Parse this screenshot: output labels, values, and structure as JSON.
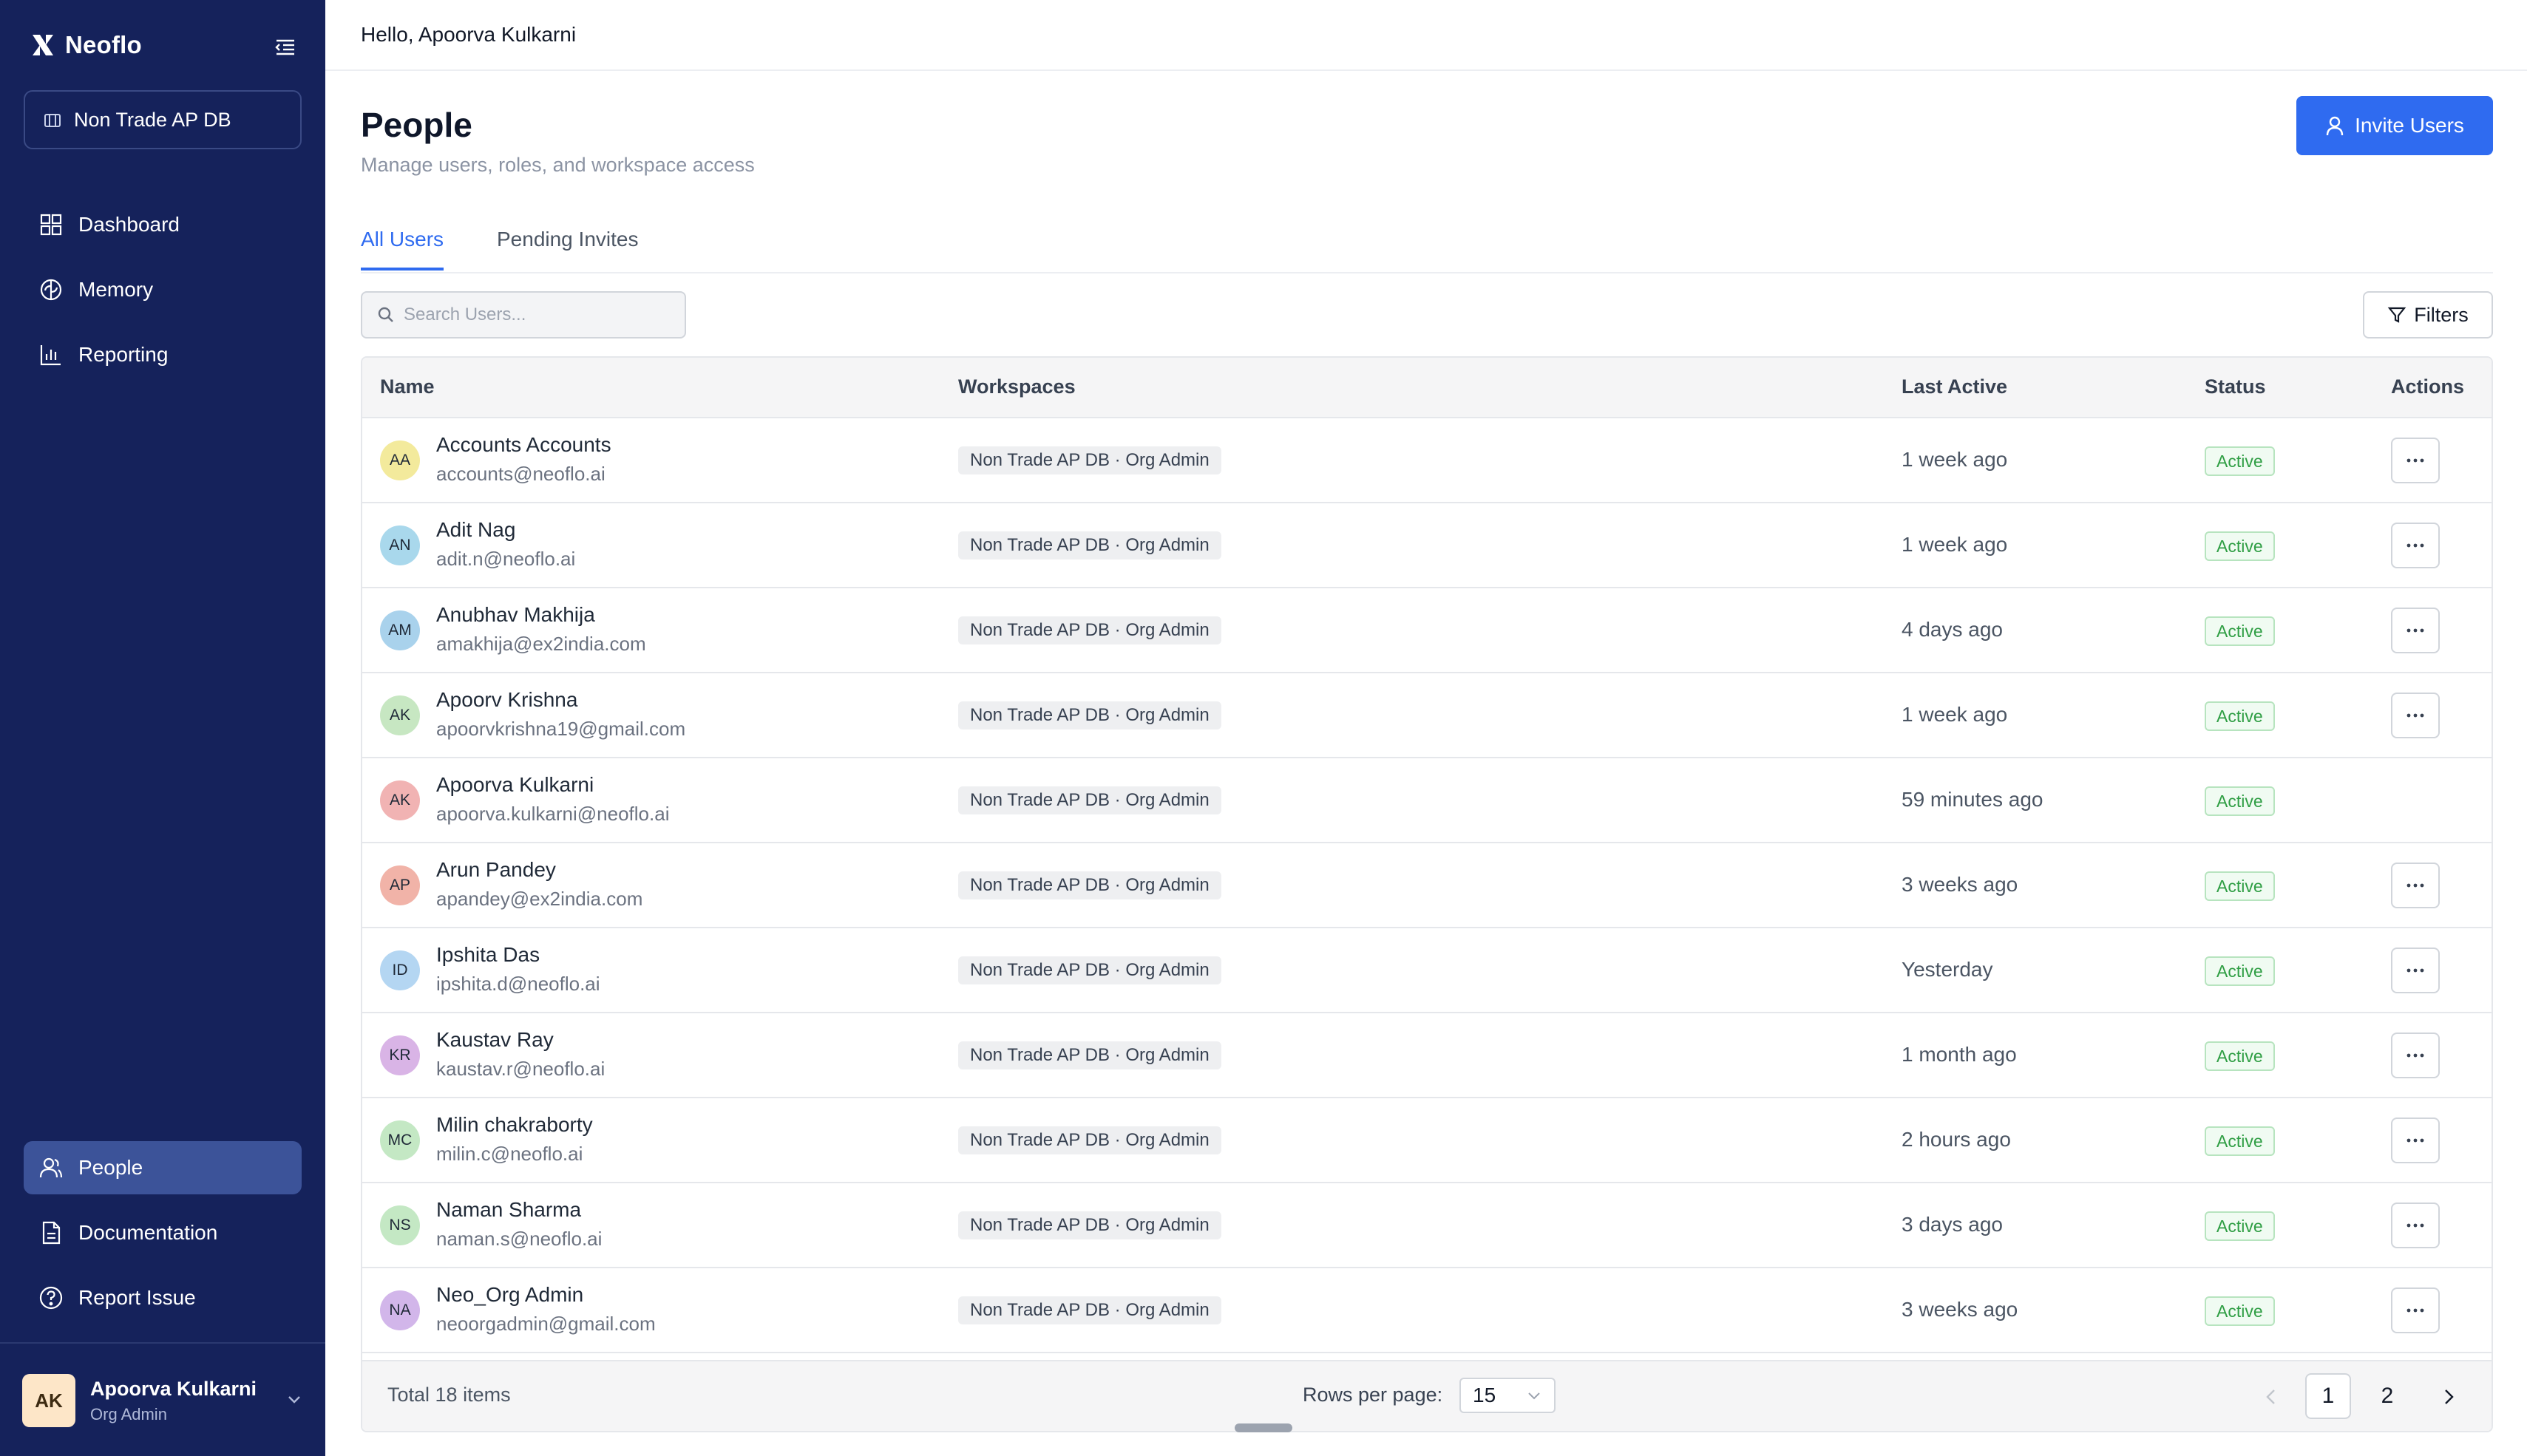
{
  "app": {
    "name": "Neoflo"
  },
  "sidebar": {
    "workspace": "Non Trade AP DB",
    "nav_top": [
      {
        "label": "Dashboard",
        "icon": "grid-icon"
      },
      {
        "label": "Memory",
        "icon": "brain-icon"
      },
      {
        "label": "Reporting",
        "icon": "bar-chart-icon"
      }
    ],
    "nav_bottom": [
      {
        "label": "People",
        "icon": "users-icon",
        "active": true
      },
      {
        "label": "Documentation",
        "icon": "document-icon"
      },
      {
        "label": "Report Issue",
        "icon": "help-circle-icon"
      }
    ],
    "user": {
      "initials": "AK",
      "name": "Apoorva Kulkarni",
      "role": "Org Admin"
    }
  },
  "header": {
    "greeting": "Hello, Apoorva Kulkarni"
  },
  "page": {
    "title": "People",
    "subtitle": "Manage users, roles, and workspace access",
    "invite_label": "Invite Users"
  },
  "tabs": [
    {
      "label": "All Users",
      "active": true
    },
    {
      "label": "Pending Invites",
      "active": false
    }
  ],
  "search": {
    "placeholder": "Search Users...",
    "value": ""
  },
  "filters_label": "Filters",
  "table": {
    "columns": [
      "Name",
      "Workspaces",
      "Last Active",
      "Status",
      "Actions"
    ],
    "rows": [
      {
        "initials": "AA",
        "avatar_color": "#f3ea9c",
        "name": "Accounts Accounts",
        "email": "accounts@neoflo.ai",
        "workspace": "Non Trade AP DB · Org Admin",
        "last_active": "1 week ago",
        "status": "Active",
        "has_action": true
      },
      {
        "initials": "AN",
        "avatar_color": "#a9d8ec",
        "name": "Adit Nag",
        "email": "adit.n@neoflo.ai",
        "workspace": "Non Trade AP DB · Org Admin",
        "last_active": "1 week ago",
        "status": "Active",
        "has_action": true
      },
      {
        "initials": "AM",
        "avatar_color": "#a9d2ec",
        "name": "Anubhav Makhija",
        "email": "amakhija@ex2india.com",
        "workspace": "Non Trade AP DB · Org Admin",
        "last_active": "4 days ago",
        "status": "Active",
        "has_action": true
      },
      {
        "initials": "AK",
        "avatar_color": "#c7e7c2",
        "name": "Apoorv Krishna",
        "email": "apoorvkrishna19@gmail.com",
        "workspace": "Non Trade AP DB · Org Admin",
        "last_active": "1 week ago",
        "status": "Active",
        "has_action": true
      },
      {
        "initials": "AK",
        "avatar_color": "#f1b3b3",
        "name": "Apoorva Kulkarni",
        "email": "apoorva.kulkarni@neoflo.ai",
        "workspace": "Non Trade AP DB · Org Admin",
        "last_active": "59 minutes ago",
        "status": "Active",
        "has_action": false
      },
      {
        "initials": "AP",
        "avatar_color": "#f1b3a8",
        "name": "Arun Pandey",
        "email": "apandey@ex2india.com",
        "workspace": "Non Trade AP DB · Org Admin",
        "last_active": "3 weeks ago",
        "status": "Active",
        "has_action": true
      },
      {
        "initials": "ID",
        "avatar_color": "#b4d6f2",
        "name": "Ipshita Das",
        "email": "ipshita.d@neoflo.ai",
        "workspace": "Non Trade AP DB · Org Admin",
        "last_active": "Yesterday",
        "status": "Active",
        "has_action": true
      },
      {
        "initials": "KR",
        "avatar_color": "#d9b4e6",
        "name": "Kaustav Ray",
        "email": "kaustav.r@neoflo.ai",
        "workspace": "Non Trade AP DB · Org Admin",
        "last_active": "1 month ago",
        "status": "Active",
        "has_action": true
      },
      {
        "initials": "MC",
        "avatar_color": "#c4e8c4",
        "name": "Milin chakraborty",
        "email": "milin.c@neoflo.ai",
        "workspace": "Non Trade AP DB · Org Admin",
        "last_active": "2 hours ago",
        "status": "Active",
        "has_action": true
      },
      {
        "initials": "NS",
        "avatar_color": "#c4e8c4",
        "name": "Naman Sharma",
        "email": "naman.s@neoflo.ai",
        "workspace": "Non Trade AP DB · Org Admin",
        "last_active": "3 days ago",
        "status": "Active",
        "has_action": true
      },
      {
        "initials": "NA",
        "avatar_color": "#d2b6ea",
        "name": "Neo_Org Admin",
        "email": "neoorgadmin@gmail.com",
        "workspace": "Non Trade AP DB · Org Admin",
        "last_active": "3 weeks ago",
        "status": "Active",
        "has_action": true
      }
    ]
  },
  "footer": {
    "total": "Total 18 items",
    "rows_per_page_label": "Rows per page:",
    "rows_per_page_value": "15",
    "pages": [
      "1",
      "2"
    ],
    "current_page": "1"
  },
  "colors": {
    "sidebar_bg": "#15225b",
    "accent": "#2f6bf0",
    "status_green": "#2f9e44"
  }
}
